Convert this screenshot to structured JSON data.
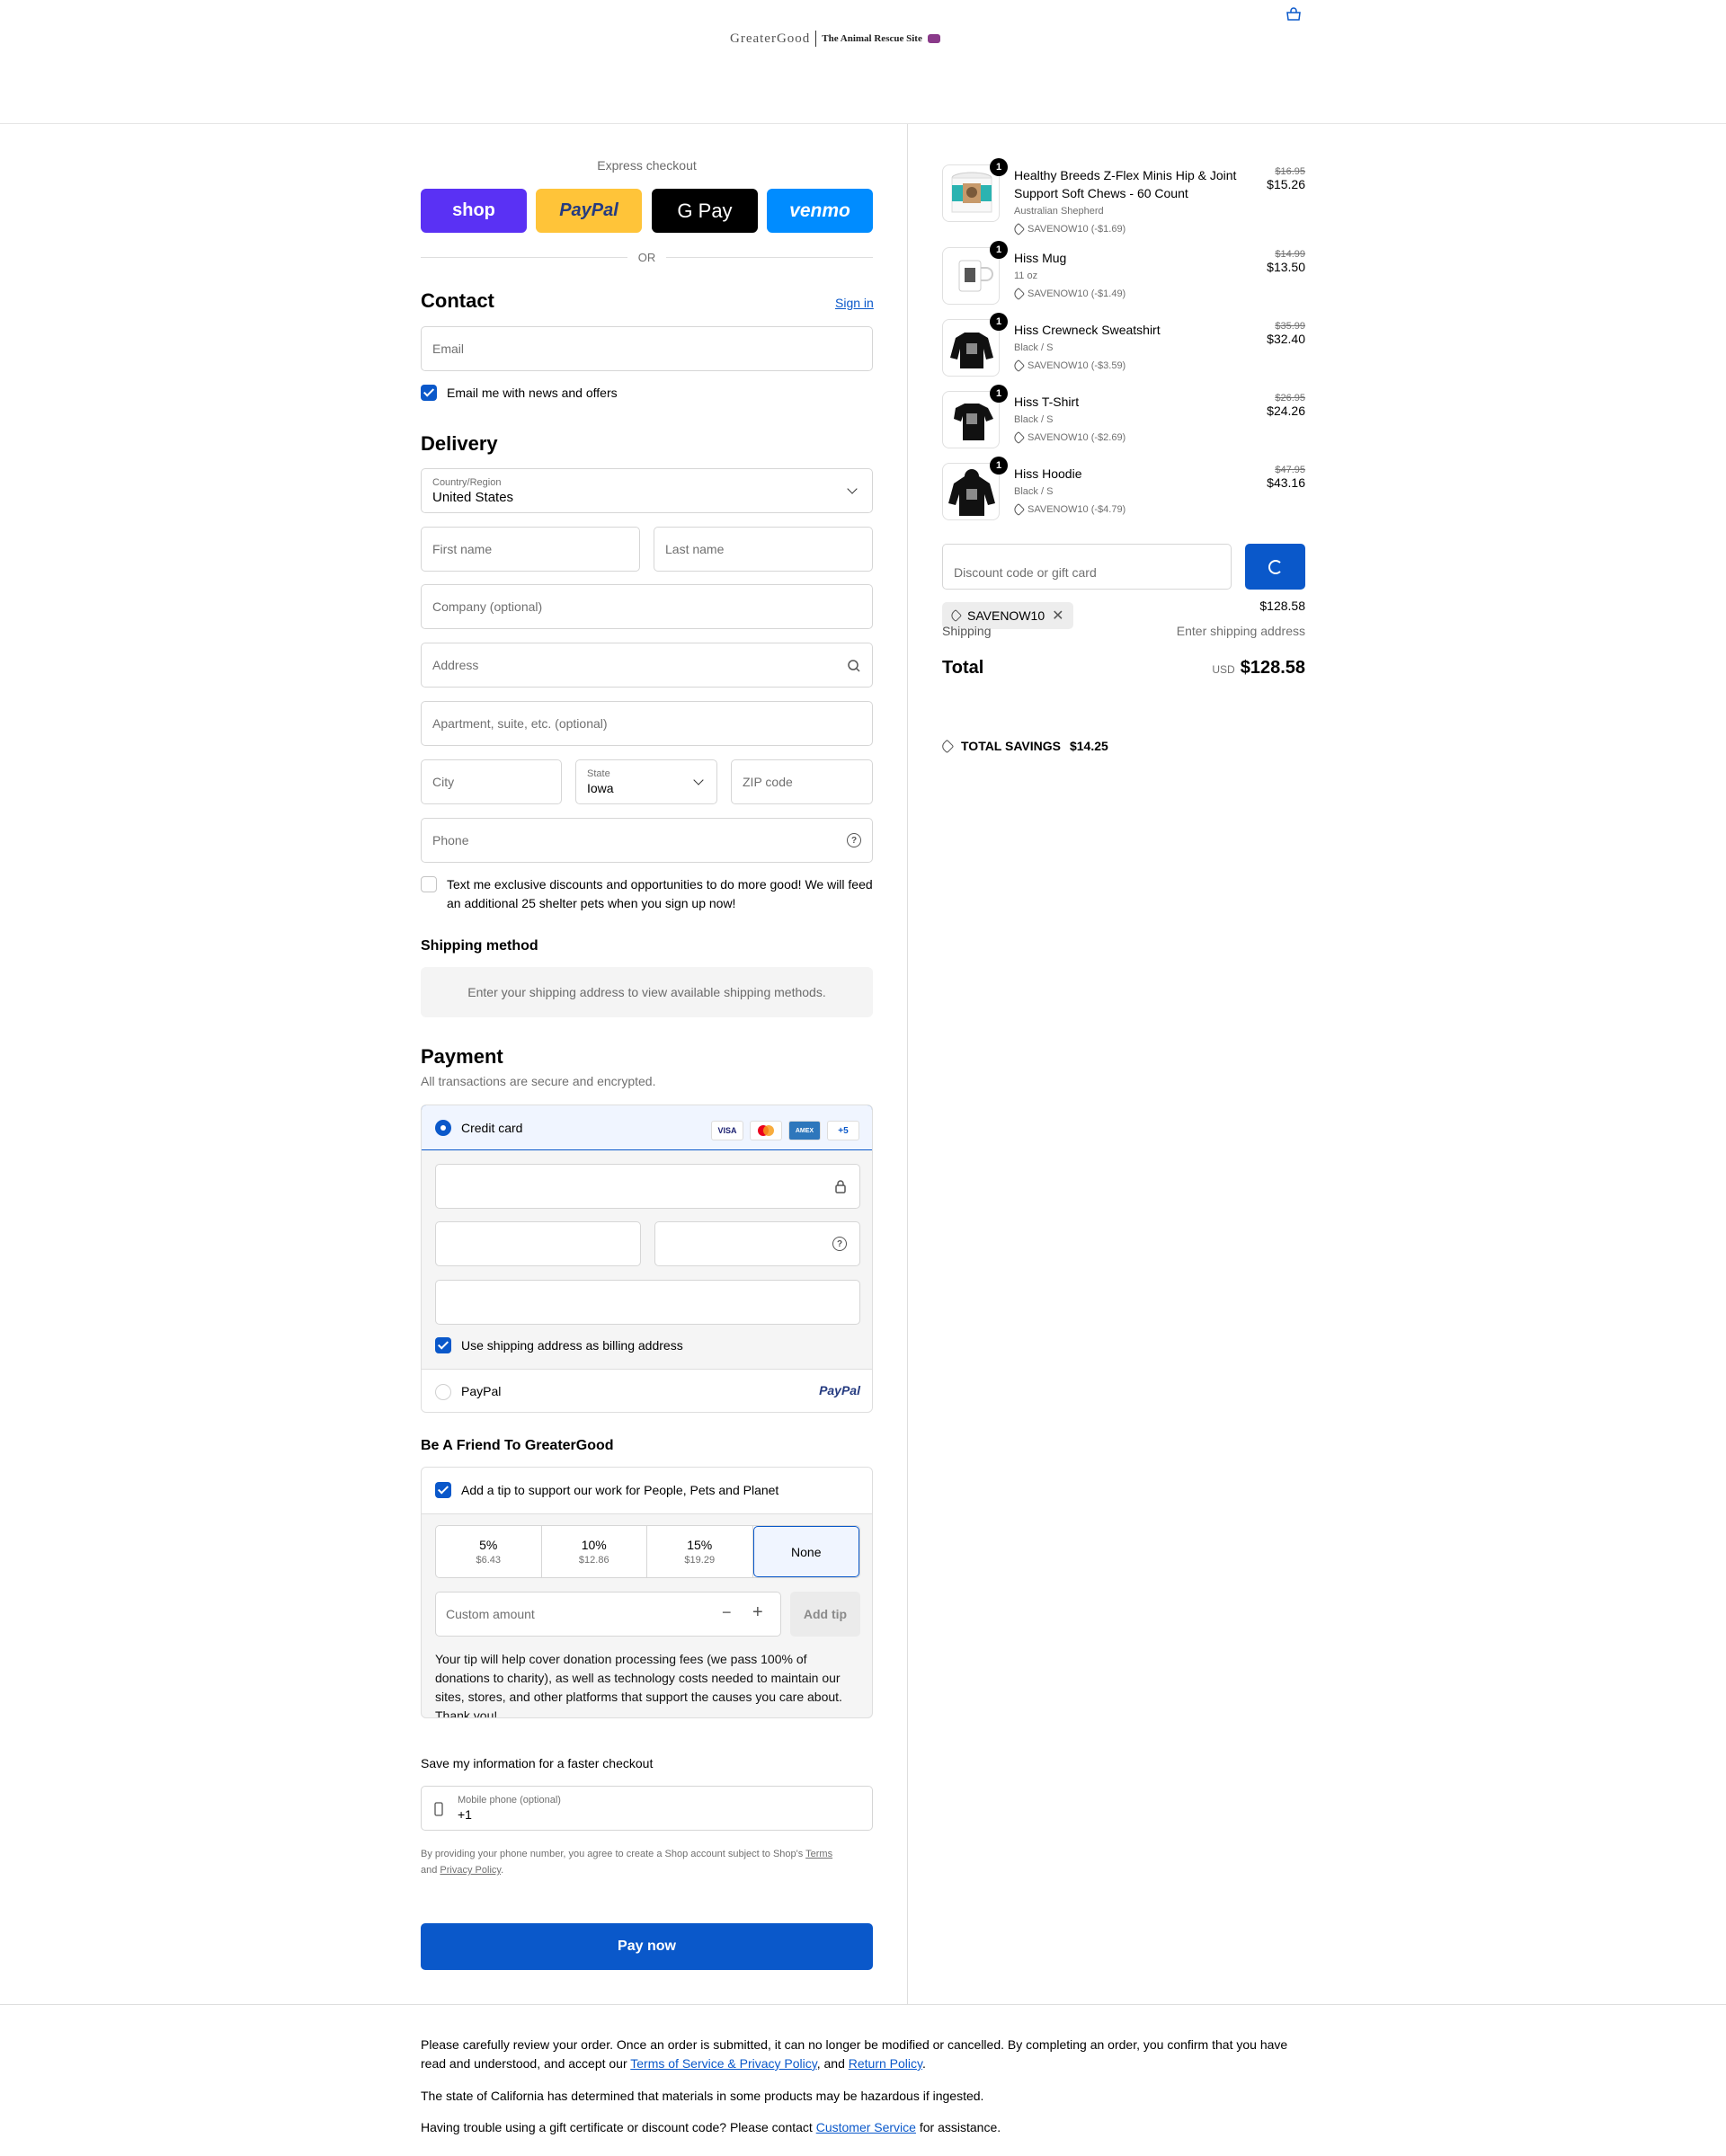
{
  "header": {
    "logo_left": "GreaterGood",
    "logo_right": "The Animal Rescue Site"
  },
  "express": {
    "label": "Express checkout",
    "shop": "shop",
    "paypal": "PayPal",
    "gpay": "G Pay",
    "venmo": "venmo",
    "or": "OR"
  },
  "contact": {
    "title": "Contact",
    "sign_in": "Sign in",
    "email_placeholder": "Email",
    "news_label": "Email me with news and offers"
  },
  "delivery": {
    "title": "Delivery",
    "country_label": "Country/Region",
    "country_value": "United States",
    "first_name": "First name",
    "last_name": "Last name",
    "company": "Company (optional)",
    "address": "Address",
    "apartment": "Apartment, suite, etc. (optional)",
    "city": "City",
    "state_label": "State",
    "state_value": "Iowa",
    "zip": "ZIP code",
    "phone": "Phone",
    "sms_label": "Text me exclusive discounts and opportunities to do more good! We will feed an additional 25 shelter pets when you sign up now!"
  },
  "shipping_method": {
    "title": "Shipping method",
    "message": "Enter your shipping address to view available shipping methods."
  },
  "payment": {
    "title": "Payment",
    "subtitle": "All transactions are secure and encrypted.",
    "credit_card": "Credit card",
    "visa": "VISA",
    "amex": "AMEX",
    "more": "+5",
    "billing_label": "Use shipping address as billing address",
    "paypal": "PayPal",
    "paypal_logo": "PayPal"
  },
  "tip": {
    "title": "Be A Friend To GreaterGood",
    "add_label": "Add a tip to support our work for People, Pets and Planet",
    "options": [
      {
        "pct": "5%",
        "amt": "$6.43"
      },
      {
        "pct": "10%",
        "amt": "$12.86"
      },
      {
        "pct": "15%",
        "amt": "$19.29"
      },
      {
        "pct": "None",
        "amt": ""
      }
    ],
    "custom_placeholder": "Custom amount",
    "add_button": "Add tip",
    "note": "Your tip will help cover donation processing fees (we pass 100% of donations to charity), as well as technology costs needed to maintain our sites, stores, and other platforms that support the causes you care about. Thank you!"
  },
  "save_info": {
    "title": "Save my information for a faster checkout",
    "phone_label": "Mobile phone (optional)",
    "phone_value": "+1",
    "legal_pre": "By providing your phone number, you agree to create a Shop account subject to Shop's",
    "terms": "Terms",
    "and": "and",
    "privacy": "Privacy Policy"
  },
  "pay_now": "Pay now",
  "cart": {
    "items": [
      {
        "qty": "1",
        "name": "Healthy Breeds Z-Flex Minis Hip & Joint Support Soft Chews - 60 Count",
        "variant": "Australian Shepherd",
        "discount": "SAVENOW10 (-$1.69)",
        "old": "$16.95",
        "price": "$15.26"
      },
      {
        "qty": "1",
        "name": "Hiss Mug",
        "variant": "11 oz",
        "discount": "SAVENOW10 (-$1.49)",
        "old": "$14.99",
        "price": "$13.50"
      },
      {
        "qty": "1",
        "name": "Hiss Crewneck Sweatshirt",
        "variant": "Black / S",
        "discount": "SAVENOW10 (-$3.59)",
        "old": "$35.99",
        "price": "$32.40"
      },
      {
        "qty": "1",
        "name": "Hiss T-Shirt",
        "variant": "Black / S",
        "discount": "SAVENOW10 (-$2.69)",
        "old": "$26.95",
        "price": "$24.26"
      },
      {
        "qty": "1",
        "name": "Hiss Hoodie",
        "variant": "Black / S",
        "discount": "SAVENOW10 (-$4.79)",
        "old": "$47.95",
        "price": "$43.16"
      }
    ],
    "discount_placeholder": "Discount code or gift card",
    "applied_code": "SAVENOW10",
    "subtotal_value": "$128.58",
    "shipping_label": "Shipping",
    "shipping_value": "Enter shipping address",
    "total_label": "Total",
    "currency": "USD",
    "total_value": "$128.58",
    "savings_label": "TOTAL SAVINGS",
    "savings_value": "$14.25"
  },
  "footer": {
    "p1_pre": "Please carefully review your order. Once an order is submitted, it can no longer be modified or cancelled. By completing an order, you confirm that you have read and understood, and accept our",
    "tos": "Terms of Service & Privacy Policy",
    "p1_mid": ", and",
    "return_policy": "Return Policy",
    "p1_end": ".",
    "p2": "The state of California has determined that materials in some products may be hazardous if ingested.",
    "p3_pre": "Having trouble using a gift certificate or discount code? Please contact",
    "customer_service": "Customer Service",
    "p3_end": "for assistance."
  }
}
